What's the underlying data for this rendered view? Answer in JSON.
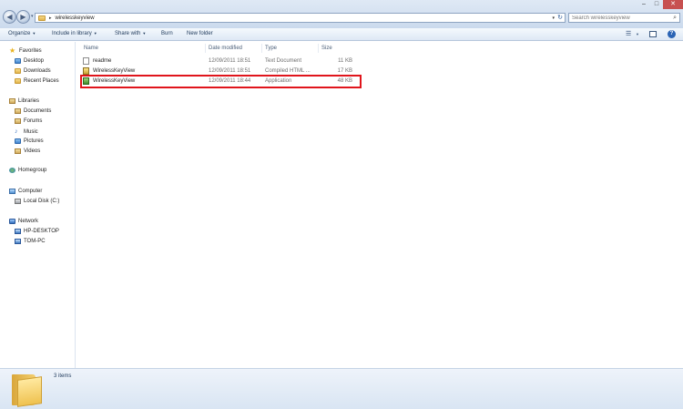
{
  "window": {
    "minimize_glyph": "–",
    "maximize_glyph": "□",
    "close_glyph": "✕"
  },
  "address_bar": {
    "back_glyph": "◀",
    "forward_glyph": "▶",
    "history_glyph": "▾",
    "separator_glyph": "▸",
    "path": "wirelesskeyview",
    "dropdown_glyph": "▾",
    "refresh_glyph": "↻"
  },
  "search": {
    "placeholder": "Search wirelesskeyview",
    "icon_glyph": "⌕"
  },
  "toolbar": {
    "organize": "Organize",
    "include_in_library": "Include in library",
    "share_with": "Share with",
    "burn": "Burn",
    "new_folder": "New folder",
    "arrow_glyph": "▼",
    "views_glyph": "☰",
    "views_arrow_glyph": "▼",
    "help_glyph": "?"
  },
  "nav": {
    "favorites": {
      "label": "Favorites",
      "items": [
        "Desktop",
        "Downloads",
        "Recent Places"
      ]
    },
    "libraries": {
      "label": "Libraries",
      "items": [
        "Documents",
        "Forums",
        "Music",
        "Pictures",
        "Videos"
      ]
    },
    "homegroup": "Homegroup",
    "computer": {
      "label": "Computer",
      "items": [
        "Local Disk (C:)"
      ]
    },
    "network": {
      "label": "Network",
      "items": [
        "HP-DESKTOP",
        "TOM-PC"
      ]
    },
    "star_glyph": "★",
    "music_glyph": "♪"
  },
  "columns": {
    "name": "Name",
    "date_modified": "Date modified",
    "type": "Type",
    "size": "Size"
  },
  "files": [
    {
      "name": "readme",
      "date": "12/09/2011 18:51",
      "type": "Text Document",
      "size": "11 KB",
      "icon": "text-file-icon"
    },
    {
      "name": "WirelessKeyView",
      "date": "12/09/2011 18:51",
      "type": "Compiled HTML ...",
      "size": "17 KB",
      "icon": "help-file-icon"
    },
    {
      "name": "WirelessKeyView",
      "date": "12/09/2011 18:44",
      "type": "Application",
      "size": "48 KB",
      "icon": "application-icon"
    }
  ],
  "highlight_color": "#e0151c",
  "details": {
    "item_count": "3 items"
  }
}
